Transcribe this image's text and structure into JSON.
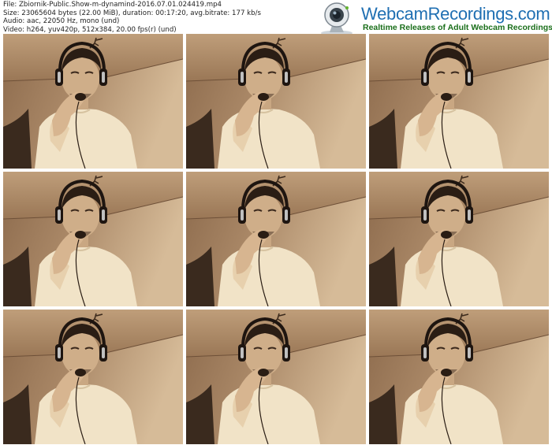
{
  "file_info": {
    "file": "File: Zbiornik-Public.Show-m-dynamind-2016.07.01.024419.mp4",
    "size": "Size: 23065604 bytes (22.00 MiB), duration: 00:17:20, avg.bitrate: 177 kb/s",
    "audio": "Audio: aac, 22050 Hz, mono (und)",
    "video": "Video: h264, yuv420p, 512x384, 20.00 fps(r) (und)"
  },
  "logo": {
    "title": "WebcamRecordings.com",
    "tagline": "Realtime Releases of Adult Webcam Recordings",
    "icon": "webcam-icon"
  },
  "colors": {
    "sepia_light": "#dcc3a3",
    "sepia_mid": "#b08a64",
    "sepia_dark": "#3a2a1e",
    "logo_blue": "#1f6fb2",
    "logo_green": "#1b6f1b"
  },
  "frames": {
    "rows": 3,
    "columns": 3,
    "count": 9
  }
}
